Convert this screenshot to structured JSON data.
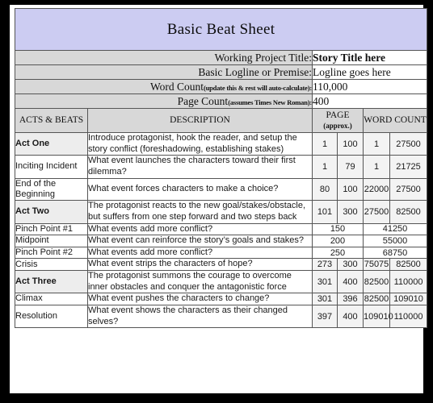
{
  "document": {
    "title": "Basic Beat Sheet",
    "title_bg": "#ccccf2"
  },
  "form": {
    "rows": [
      {
        "label": "Working Project Title:",
        "note": "",
        "value": "Story Title here",
        "bold": true
      },
      {
        "label": "Basic Logline or Premise:",
        "note": "",
        "value": "Logline goes here",
        "bold": false
      },
      {
        "label": "Word Count",
        "note": "(update this &  rest will auto-calculate):",
        "value": "110,000",
        "bold": false
      },
      {
        "label": "Page Count",
        "note": "(assumes Times New Roman):",
        "value": "400",
        "bold": false
      }
    ]
  },
  "table": {
    "headers": {
      "beats": "ACTS & BEATS",
      "description": "DESCRIPTION",
      "page": "PAGE",
      "page_sub": "(approx.)",
      "word_count": "WORD COUNT"
    },
    "rows": [
      {
        "beat": "Act One",
        "is_act": true,
        "description": "Introduce protagonist, hook the reader, and setup the story conflict (foreshadowing, establishing stakes)",
        "merged": false,
        "page_start": "1",
        "page_end": "100",
        "word_start": "1",
        "word_end": "27500"
      },
      {
        "beat": "Inciting Incident",
        "is_act": false,
        "description": "What event launches the characters toward their first dilemma?",
        "merged": false,
        "page_start": "1",
        "page_end": "79",
        "word_start": "1",
        "word_end": "21725"
      },
      {
        "beat": "End of the Beginning",
        "is_act": false,
        "description": "What event forces characters to make a choice?",
        "merged": false,
        "page_start": "80",
        "page_end": "100",
        "word_start": "22000",
        "word_end": "27500"
      },
      {
        "beat": "Act Two",
        "is_act": true,
        "description": "The protagonist reacts to the new goal/stakes/obstacle, but suffers from one step forward and two steps back",
        "merged": false,
        "page_start": "101",
        "page_end": "300",
        "word_start": "27500",
        "word_end": "82500"
      },
      {
        "beat": "Pinch Point #1",
        "is_act": false,
        "description": "What events add more conflict?",
        "merged": true,
        "page": "150",
        "word": "41250"
      },
      {
        "beat": "Midpoint",
        "is_act": false,
        "description": "What event can reinforce the story’s goals and stakes?",
        "merged": true,
        "page": "200",
        "word": "55000"
      },
      {
        "beat": "Pinch Point #2",
        "is_act": false,
        "description": "What events add more conflict?",
        "merged": true,
        "page": "250",
        "word": "68750"
      },
      {
        "beat": "Crisis",
        "is_act": false,
        "description": "What event strips the characters of hope?",
        "merged": false,
        "page_start": "273",
        "page_end": "300",
        "word_start": "75075",
        "word_end": "82500"
      },
      {
        "beat": "Act Three",
        "is_act": true,
        "description": "The protagonist summons the courage to overcome inner obstacles and conquer the antagonistic force",
        "merged": false,
        "page_start": "301",
        "page_end": "400",
        "word_start": "82500",
        "word_end": "110000"
      },
      {
        "beat": "Climax",
        "is_act": false,
        "description": "What event pushes the characters to change?",
        "merged": false,
        "page_start": "301",
        "page_end": "396",
        "word_start": "82500",
        "word_end": "109010"
      },
      {
        "beat": "Resolution",
        "is_act": false,
        "description": "What event shows the characters as their changed selves?",
        "merged": false,
        "page_start": "397",
        "page_end": "400",
        "word_start": "109010",
        "word_end": "110000"
      }
    ]
  }
}
